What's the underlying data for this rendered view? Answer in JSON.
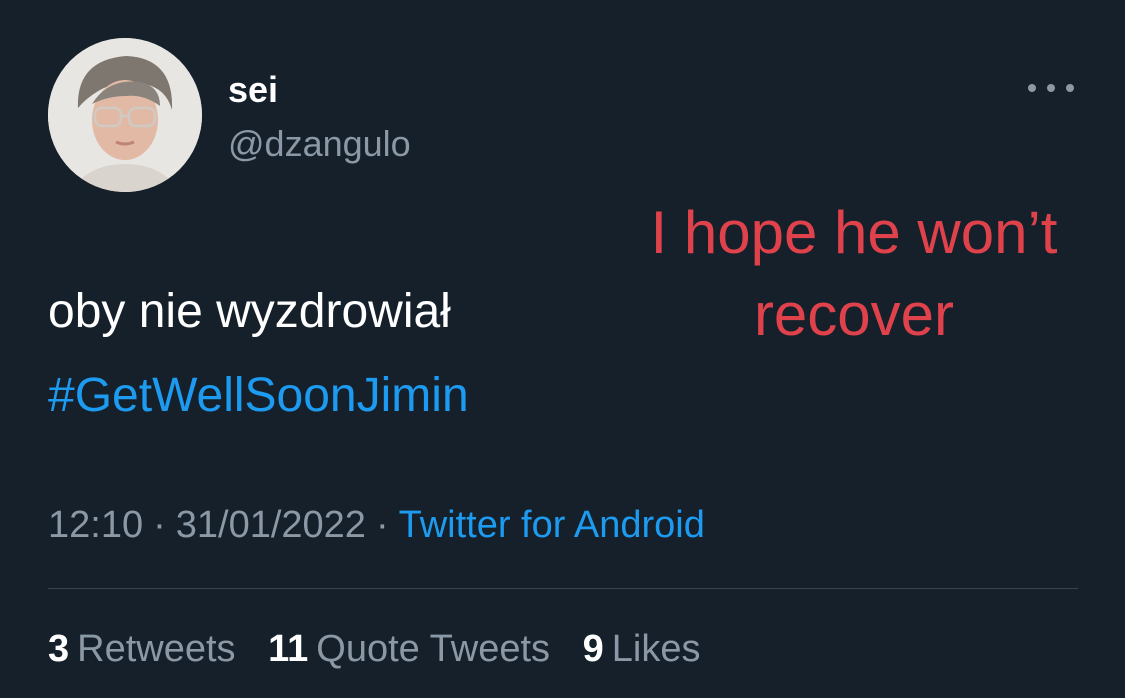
{
  "author": {
    "display_name": "sei",
    "handle": "@dzangulo",
    "avatar_icon": "profile-photo"
  },
  "more_icon": "more-options-icon",
  "tweet": {
    "text": "oby nie wyzdrowiał",
    "hashtag": "#GetWellSoonJimin"
  },
  "annotation": {
    "line1": "I hope he won’t",
    "line2": "recover",
    "color": "#e0424c"
  },
  "meta": {
    "time": "12:10",
    "separator": "·",
    "date": "31/01/2022",
    "source": "Twitter for Android"
  },
  "stats": {
    "retweets_count": "3",
    "retweets_label": "Retweets",
    "quotes_count": "11",
    "quotes_label": "Quote Tweets",
    "likes_count": "9",
    "likes_label": "Likes"
  },
  "colors": {
    "background": "#15202b",
    "primary_text": "#ffffff",
    "secondary_text": "#8b98a5",
    "link": "#1d9bf0",
    "divider": "#38444d"
  }
}
